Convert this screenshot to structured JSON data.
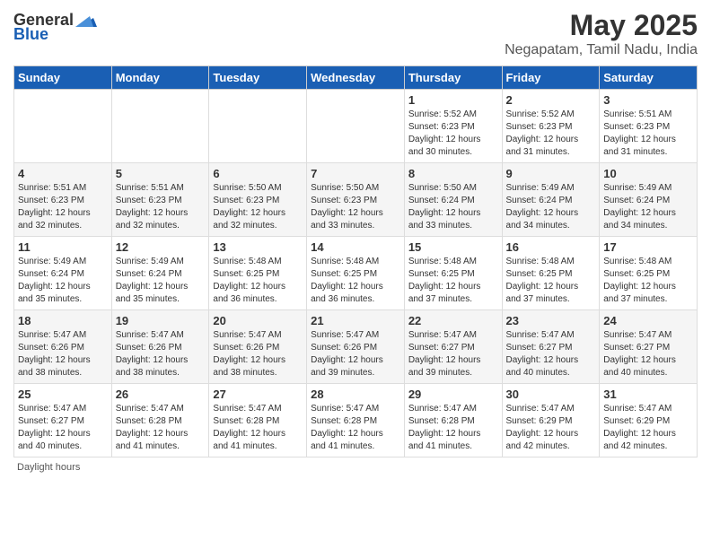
{
  "logo": {
    "text_general": "General",
    "text_blue": "Blue"
  },
  "title": "May 2025",
  "location": "Negapatam, Tamil Nadu, India",
  "days_of_week": [
    "Sunday",
    "Monday",
    "Tuesday",
    "Wednesday",
    "Thursday",
    "Friday",
    "Saturday"
  ],
  "footer": "Daylight hours",
  "weeks": [
    [
      {
        "day": "",
        "info": ""
      },
      {
        "day": "",
        "info": ""
      },
      {
        "day": "",
        "info": ""
      },
      {
        "day": "",
        "info": ""
      },
      {
        "day": "1",
        "info": "Sunrise: 5:52 AM\nSunset: 6:23 PM\nDaylight: 12 hours and 30 minutes."
      },
      {
        "day": "2",
        "info": "Sunrise: 5:52 AM\nSunset: 6:23 PM\nDaylight: 12 hours and 31 minutes."
      },
      {
        "day": "3",
        "info": "Sunrise: 5:51 AM\nSunset: 6:23 PM\nDaylight: 12 hours and 31 minutes."
      }
    ],
    [
      {
        "day": "4",
        "info": "Sunrise: 5:51 AM\nSunset: 6:23 PM\nDaylight: 12 hours and 32 minutes."
      },
      {
        "day": "5",
        "info": "Sunrise: 5:51 AM\nSunset: 6:23 PM\nDaylight: 12 hours and 32 minutes."
      },
      {
        "day": "6",
        "info": "Sunrise: 5:50 AM\nSunset: 6:23 PM\nDaylight: 12 hours and 32 minutes."
      },
      {
        "day": "7",
        "info": "Sunrise: 5:50 AM\nSunset: 6:23 PM\nDaylight: 12 hours and 33 minutes."
      },
      {
        "day": "8",
        "info": "Sunrise: 5:50 AM\nSunset: 6:24 PM\nDaylight: 12 hours and 33 minutes."
      },
      {
        "day": "9",
        "info": "Sunrise: 5:49 AM\nSunset: 6:24 PM\nDaylight: 12 hours and 34 minutes."
      },
      {
        "day": "10",
        "info": "Sunrise: 5:49 AM\nSunset: 6:24 PM\nDaylight: 12 hours and 34 minutes."
      }
    ],
    [
      {
        "day": "11",
        "info": "Sunrise: 5:49 AM\nSunset: 6:24 PM\nDaylight: 12 hours and 35 minutes."
      },
      {
        "day": "12",
        "info": "Sunrise: 5:49 AM\nSunset: 6:24 PM\nDaylight: 12 hours and 35 minutes."
      },
      {
        "day": "13",
        "info": "Sunrise: 5:48 AM\nSunset: 6:25 PM\nDaylight: 12 hours and 36 minutes."
      },
      {
        "day": "14",
        "info": "Sunrise: 5:48 AM\nSunset: 6:25 PM\nDaylight: 12 hours and 36 minutes."
      },
      {
        "day": "15",
        "info": "Sunrise: 5:48 AM\nSunset: 6:25 PM\nDaylight: 12 hours and 37 minutes."
      },
      {
        "day": "16",
        "info": "Sunrise: 5:48 AM\nSunset: 6:25 PM\nDaylight: 12 hours and 37 minutes."
      },
      {
        "day": "17",
        "info": "Sunrise: 5:48 AM\nSunset: 6:25 PM\nDaylight: 12 hours and 37 minutes."
      }
    ],
    [
      {
        "day": "18",
        "info": "Sunrise: 5:47 AM\nSunset: 6:26 PM\nDaylight: 12 hours and 38 minutes."
      },
      {
        "day": "19",
        "info": "Sunrise: 5:47 AM\nSunset: 6:26 PM\nDaylight: 12 hours and 38 minutes."
      },
      {
        "day": "20",
        "info": "Sunrise: 5:47 AM\nSunset: 6:26 PM\nDaylight: 12 hours and 38 minutes."
      },
      {
        "day": "21",
        "info": "Sunrise: 5:47 AM\nSunset: 6:26 PM\nDaylight: 12 hours and 39 minutes."
      },
      {
        "day": "22",
        "info": "Sunrise: 5:47 AM\nSunset: 6:27 PM\nDaylight: 12 hours and 39 minutes."
      },
      {
        "day": "23",
        "info": "Sunrise: 5:47 AM\nSunset: 6:27 PM\nDaylight: 12 hours and 40 minutes."
      },
      {
        "day": "24",
        "info": "Sunrise: 5:47 AM\nSunset: 6:27 PM\nDaylight: 12 hours and 40 minutes."
      }
    ],
    [
      {
        "day": "25",
        "info": "Sunrise: 5:47 AM\nSunset: 6:27 PM\nDaylight: 12 hours and 40 minutes."
      },
      {
        "day": "26",
        "info": "Sunrise: 5:47 AM\nSunset: 6:28 PM\nDaylight: 12 hours and 41 minutes."
      },
      {
        "day": "27",
        "info": "Sunrise: 5:47 AM\nSunset: 6:28 PM\nDaylight: 12 hours and 41 minutes."
      },
      {
        "day": "28",
        "info": "Sunrise: 5:47 AM\nSunset: 6:28 PM\nDaylight: 12 hours and 41 minutes."
      },
      {
        "day": "29",
        "info": "Sunrise: 5:47 AM\nSunset: 6:28 PM\nDaylight: 12 hours and 41 minutes."
      },
      {
        "day": "30",
        "info": "Sunrise: 5:47 AM\nSunset: 6:29 PM\nDaylight: 12 hours and 42 minutes."
      },
      {
        "day": "31",
        "info": "Sunrise: 5:47 AM\nSunset: 6:29 PM\nDaylight: 12 hours and 42 minutes."
      }
    ]
  ]
}
